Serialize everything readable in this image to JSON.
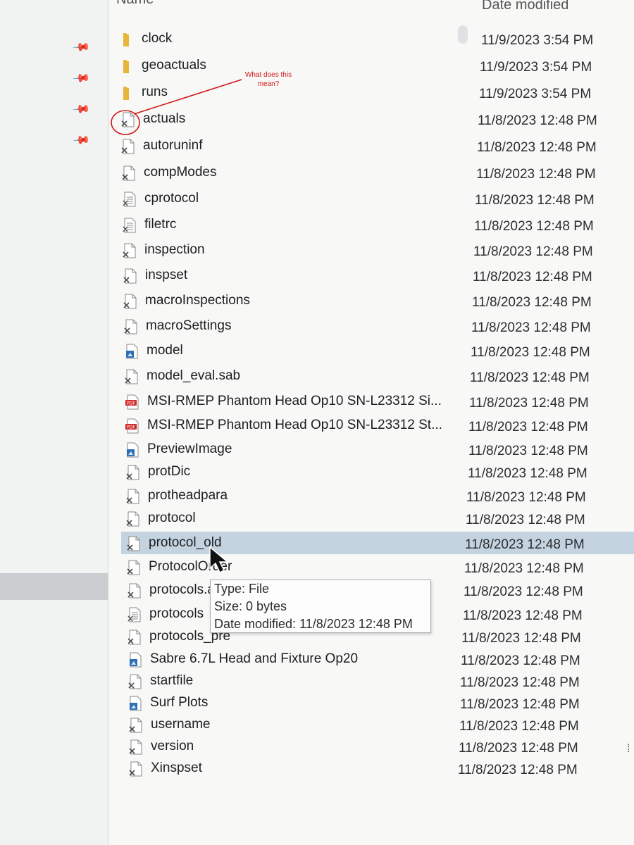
{
  "columns": {
    "name": "Name",
    "date_modified": "Date modified"
  },
  "navigation": {
    "pinned_icons": [
      "pin-icon",
      "pin-icon",
      "pin-icon",
      "pin-icon"
    ]
  },
  "files": [
    {
      "name": "clock",
      "date": "11/9/2023 3:54 PM",
      "icon": "folder-icon"
    },
    {
      "name": "geoactuals",
      "date": "11/9/2023 3:54 PM",
      "icon": "folder-icon"
    },
    {
      "name": "runs",
      "date": "11/9/2023 3:54 PM",
      "icon": "folder-icon"
    },
    {
      "name": "actuals",
      "date": "11/8/2023 12:48 PM",
      "icon": "generic-file-icon"
    },
    {
      "name": "autoruninf",
      "date": "11/8/2023 12:48 PM",
      "icon": "generic-file-icon"
    },
    {
      "name": "compModes",
      "date": "11/8/2023 12:48 PM",
      "icon": "generic-file-icon"
    },
    {
      "name": "cprotocol",
      "date": "11/8/2023 12:48 PM",
      "icon": "text-file-icon"
    },
    {
      "name": "filetrc",
      "date": "11/8/2023 12:48 PM",
      "icon": "text-file-icon"
    },
    {
      "name": "inspection",
      "date": "11/8/2023 12:48 PM",
      "icon": "generic-file-icon"
    },
    {
      "name": "inspset",
      "date": "11/8/2023 12:48 PM",
      "icon": "generic-file-icon"
    },
    {
      "name": "macroInspections",
      "date": "11/8/2023 12:48 PM",
      "icon": "generic-file-icon"
    },
    {
      "name": "macroSettings",
      "date": "11/8/2023 12:48 PM",
      "icon": "generic-file-icon"
    },
    {
      "name": "model",
      "date": "11/8/2023 12:48 PM",
      "icon": "image-file-icon"
    },
    {
      "name": "model_eval.sab",
      "date": "11/8/2023 12:48 PM",
      "icon": "generic-file-icon"
    },
    {
      "name": "MSI-RMEP Phantom Head Op10 SN-L23312 Si...",
      "date": "11/8/2023 12:48 PM",
      "icon": "pdf-file-icon"
    },
    {
      "name": "MSI-RMEP Phantom Head Op10 SN-L23312 St...",
      "date": "11/8/2023 12:48 PM",
      "icon": "pdf-file-icon"
    },
    {
      "name": "PreviewImage",
      "date": "11/8/2023 12:48 PM",
      "icon": "image-file-icon"
    },
    {
      "name": "protDic",
      "date": "11/8/2023 12:48 PM",
      "icon": "generic-file-icon"
    },
    {
      "name": "protheadpara",
      "date": "11/8/2023 12:48 PM",
      "icon": "generic-file-icon"
    },
    {
      "name": "protocol",
      "date": "11/8/2023 12:48 PM",
      "icon": "generic-file-icon"
    },
    {
      "name": "protocol_old",
      "date": "11/8/2023 12:48 PM",
      "icon": "generic-file-icon",
      "highlighted": true
    },
    {
      "name": "ProtocolOrder",
      "date": "11/8/2023 12:48 PM",
      "icon": "generic-file-icon"
    },
    {
      "name": "protocols.a",
      "date": "11/8/2023 12:48 PM",
      "icon": "generic-file-icon"
    },
    {
      "name": "protocols",
      "date": "11/8/2023 12:48 PM",
      "icon": "text-file-icon"
    },
    {
      "name": "protocols_pre",
      "date": "11/8/2023 12:48 PM",
      "icon": "generic-file-icon"
    },
    {
      "name": "Sabre 6.7L Head and Fixture Op20",
      "date": "11/8/2023 12:48 PM",
      "icon": "image-file-icon"
    },
    {
      "name": "startfile",
      "date": "11/8/2023 12:48 PM",
      "icon": "generic-file-icon"
    },
    {
      "name": "Surf Plots",
      "date": "11/8/2023 12:48 PM",
      "icon": "image-file-icon"
    },
    {
      "name": "username",
      "date": "11/8/2023 12:48 PM",
      "icon": "generic-file-icon"
    },
    {
      "name": "version",
      "date": "11/8/2023 12:48 PM",
      "icon": "generic-file-icon"
    },
    {
      "name": "Xinspset",
      "date": "11/8/2023 12:48 PM",
      "icon": "generic-file-icon"
    }
  ],
  "tooltip": {
    "type": "Type: File",
    "size": "Size: 0 bytes",
    "date": "Date modified: 11/8/2023 12:48 PM"
  },
  "annotation": {
    "text": "What does this mean?",
    "color": "#d01818"
  },
  "colors": {
    "selection": "#c3d3e0",
    "folder": "#e8b53b",
    "pdf": "#d32d2d",
    "image": "#2f6fb5"
  }
}
